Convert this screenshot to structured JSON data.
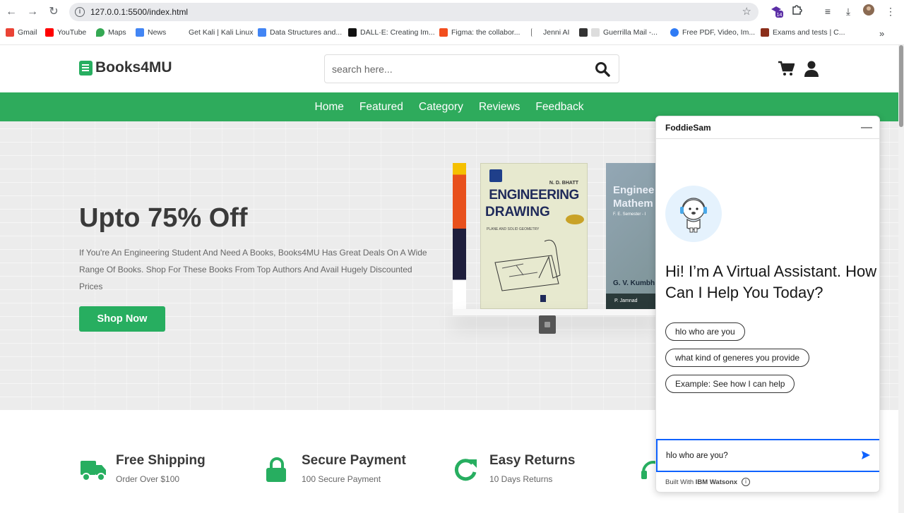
{
  "browser": {
    "url": "127.0.0.1:5500/index.html",
    "bookmarks": [
      {
        "label": "Gmail",
        "color": "#ea4335"
      },
      {
        "label": "YouTube",
        "color": "#ff0000"
      },
      {
        "label": "Maps",
        "color": "#34a853"
      },
      {
        "label": "News",
        "color": "#4285f4"
      },
      {
        "label": "Get Kali | Kali Linux",
        "color": "#ffffff"
      },
      {
        "label": "Data Structures and...",
        "color": "#4285f4"
      },
      {
        "label": "DALL·E: Creating Im...",
        "color": "#111111"
      },
      {
        "label": "Figma: the collabor...",
        "color": "#f24e1e"
      },
      {
        "label": "Jenni AI",
        "color": "#ffffff"
      },
      {
        "label": "Guerrilla Mail -...",
        "color": "#333333"
      },
      {
        "label": "Free PDF, Video, Im...",
        "color": "#2f7bf5"
      },
      {
        "label": "Exams and tests | C...",
        "color": "#8b2e1a"
      }
    ],
    "badge": "14"
  },
  "header": {
    "logo": "Books4MU",
    "search_placeholder": "search here..."
  },
  "menu": [
    "Home",
    "Featured",
    "Category",
    "Reviews",
    "Feedback"
  ],
  "hero": {
    "title": "Upto 75% Off",
    "text": "If You're An Engineering Student And Need A Books, Books4MU Has Great Deals On A Wide Range Of Books. Shop For These Books From Top Authors And Avail Hugely Discounted Prices",
    "button": "Shop Now",
    "book1": {
      "author": "N. D. BHATT",
      "title1": "ENGINEERING",
      "title2": "DRAWING",
      "sub": "PLANE AND SOLID GEOMETRY"
    },
    "book2": {
      "title1": "Enginee",
      "title2": "Mathem",
      "sub": "F. E. Semester - I",
      "author": "G. V. Kumbh",
      "publisher": "P. Jamnad"
    }
  },
  "features": [
    {
      "title": "Free Shipping",
      "sub": "Order Over $100"
    },
    {
      "title": "Secure Payment",
      "sub": "100 Secure Payment"
    },
    {
      "title": "Easy Returns",
      "sub": "10 Days Returns"
    }
  ],
  "chat": {
    "title": "FoddieSam",
    "greeting": "Hi! I’m A Virtual Assistant. How Can I Help You Today?",
    "suggestions": [
      "hlo who are you",
      "what kind of generes you provide",
      "Example: See how I can help"
    ],
    "input_value": "hlo who are you?",
    "built_with": "Built With",
    "brand": "IBM Watsonx"
  },
  "colors": {
    "accent": "#2eab5c",
    "chat_focus": "#0f62fe"
  }
}
